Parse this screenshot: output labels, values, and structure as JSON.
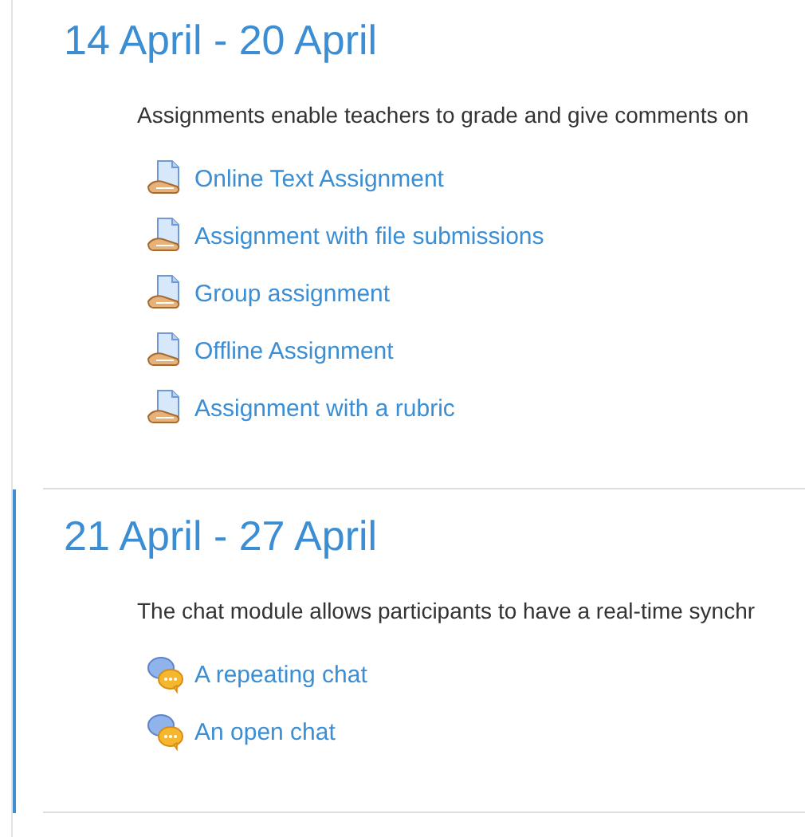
{
  "sections": [
    {
      "title": "14 April - 20 April",
      "current": false,
      "description": "Assignments enable teachers to grade and give comments on",
      "activities": [
        {
          "kind": "assignment",
          "label": "Online Text Assignment"
        },
        {
          "kind": "assignment",
          "label": "Assignment with file submissions"
        },
        {
          "kind": "assignment",
          "label": "Group assignment"
        },
        {
          "kind": "assignment",
          "label": "Offline Assignment"
        },
        {
          "kind": "assignment",
          "label": "Assignment with a rubric"
        }
      ]
    },
    {
      "title": "21 April - 27 April",
      "current": true,
      "description": "The chat module allows participants to have a real-time synchr",
      "activities": [
        {
          "kind": "chat",
          "label": "A repeating chat"
        },
        {
          "kind": "chat",
          "label": "An open chat"
        }
      ]
    }
  ]
}
